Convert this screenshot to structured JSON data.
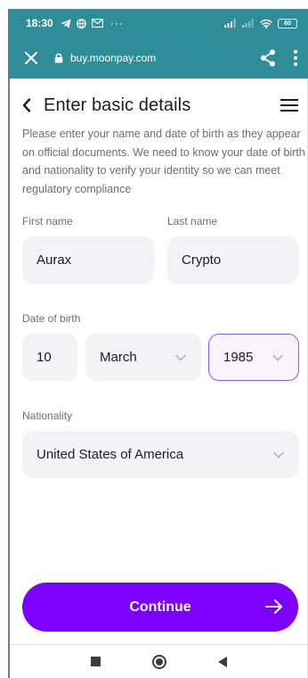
{
  "status_bar": {
    "time": "18:30",
    "more": "···",
    "battery": "60",
    "left_icons": [
      "telegram-icon",
      "globe-icon",
      "gmail-icon"
    ],
    "right_icons": [
      "signal-icon",
      "signal-icon",
      "wifi-icon",
      "battery-icon"
    ]
  },
  "browser": {
    "url": "buy.moonpay.com",
    "bar_color": "#2f8d99"
  },
  "page": {
    "title": "Enter basic details",
    "intro": "Please enter your name and date of birth as they appear on official documents. We need to know your date of birth and nationality to verify your identity so we can meet regulatory compliance"
  },
  "form": {
    "first_name_label": "First name",
    "first_name_value": "Aurax",
    "last_name_label": "Last name",
    "last_name_value": "Crypto",
    "dob_label": "Date of birth",
    "dob_day": "10",
    "dob_month": "March",
    "dob_year": "1985",
    "nationality_label": "Nationality",
    "nationality_value": "United States of America"
  },
  "actions": {
    "continue_label": "Continue",
    "accent_color": "#7d00ff"
  }
}
